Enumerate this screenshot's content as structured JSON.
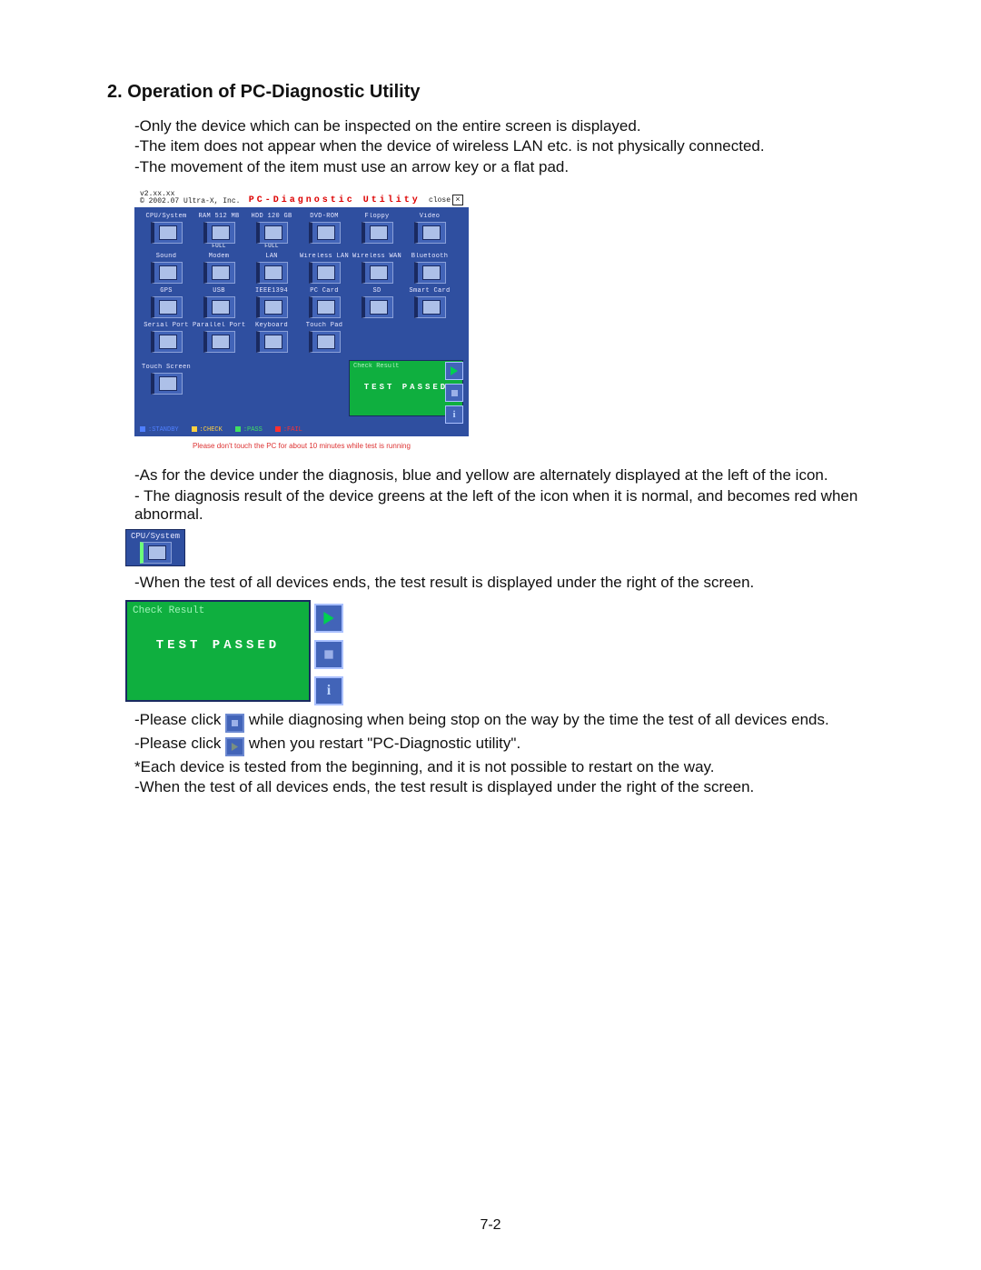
{
  "heading": "2. Operation of PC-Diagnostic Utility",
  "intro": [
    "-Only the device which can be inspected on the entire screen is displayed.",
    "-The item does not appear when the device of wireless LAN etc. is not physically connected.",
    "-The movement of the item must use an arrow key or a flat pad."
  ],
  "diag": {
    "version": "v2.xx.xx",
    "copyright": "© 2002.07 Ultra-X, Inc.",
    "title": "PC-Diagnostic Utility",
    "close": "close",
    "devices": [
      {
        "label": "CPU/System",
        "sub": ""
      },
      {
        "label": "RAM 512 MB",
        "sub": "FULL"
      },
      {
        "label": "HDD 120 GB",
        "sub": "FULL"
      },
      {
        "label": "DVD-ROM",
        "sub": ""
      },
      {
        "label": "Floppy",
        "sub": ""
      },
      {
        "label": "Video",
        "sub": ""
      },
      {
        "label": "Sound",
        "sub": ""
      },
      {
        "label": "Modem",
        "sub": ""
      },
      {
        "label": "LAN",
        "sub": ""
      },
      {
        "label": "Wireless LAN",
        "sub": ""
      },
      {
        "label": "Wireless WAN",
        "sub": ""
      },
      {
        "label": "Bluetooth",
        "sub": ""
      },
      {
        "label": "GPS",
        "sub": ""
      },
      {
        "label": "USB",
        "sub": ""
      },
      {
        "label": "IEEE1394",
        "sub": ""
      },
      {
        "label": "PC Card",
        "sub": ""
      },
      {
        "label": "SD",
        "sub": ""
      },
      {
        "label": "Smart Card",
        "sub": ""
      },
      {
        "label": "Serial Port",
        "sub": ""
      },
      {
        "label": "Parallel Port",
        "sub": ""
      },
      {
        "label": "Keyboard",
        "sub": ""
      },
      {
        "label": "Touch Pad",
        "sub": ""
      },
      {
        "label": "Touch Screen",
        "sub": ""
      }
    ],
    "check_label": "Check Result",
    "check_result": "TEST PASSED",
    "legend": [
      {
        "color": "#4f7fff",
        "text": ":STANDBY"
      },
      {
        "color": "#ffd040",
        "text": ":CHECK"
      },
      {
        "color": "#40e060",
        "text": ":PASS"
      },
      {
        "color": "#ff3030",
        "text": ":FAIL"
      }
    ],
    "warning": "Please don't touch the PC for about 10 minutes while test is running"
  },
  "after1": [
    "-As for the device under the diagnosis, blue and yellow are alternately displayed at the left of the icon.",
    "- The diagnosis result of the device greens at the left of the icon when it is normal, and becomes red when abnormal."
  ],
  "cpu_tile": "CPU/System",
  "after2": "-When the test of all devices ends, the test result is displayed under the right of the screen.",
  "big_check": {
    "label": "Check Result",
    "result": "TEST PASSED"
  },
  "after3a_pre": "-Please click ",
  "after3a_post": " while diagnosing when being stop on the way by the time the test of all devices ends.",
  "after3b_pre": "-Please click ",
  "after3b_post": " when you restart \"PC-Diagnostic utility\".",
  "after3c": "*Each device is tested from the beginning, and it is not possible to restart on the way.",
  "after3d": "-When the test of all devices ends, the test result is displayed under the right of the screen.",
  "page_number": "7-2"
}
